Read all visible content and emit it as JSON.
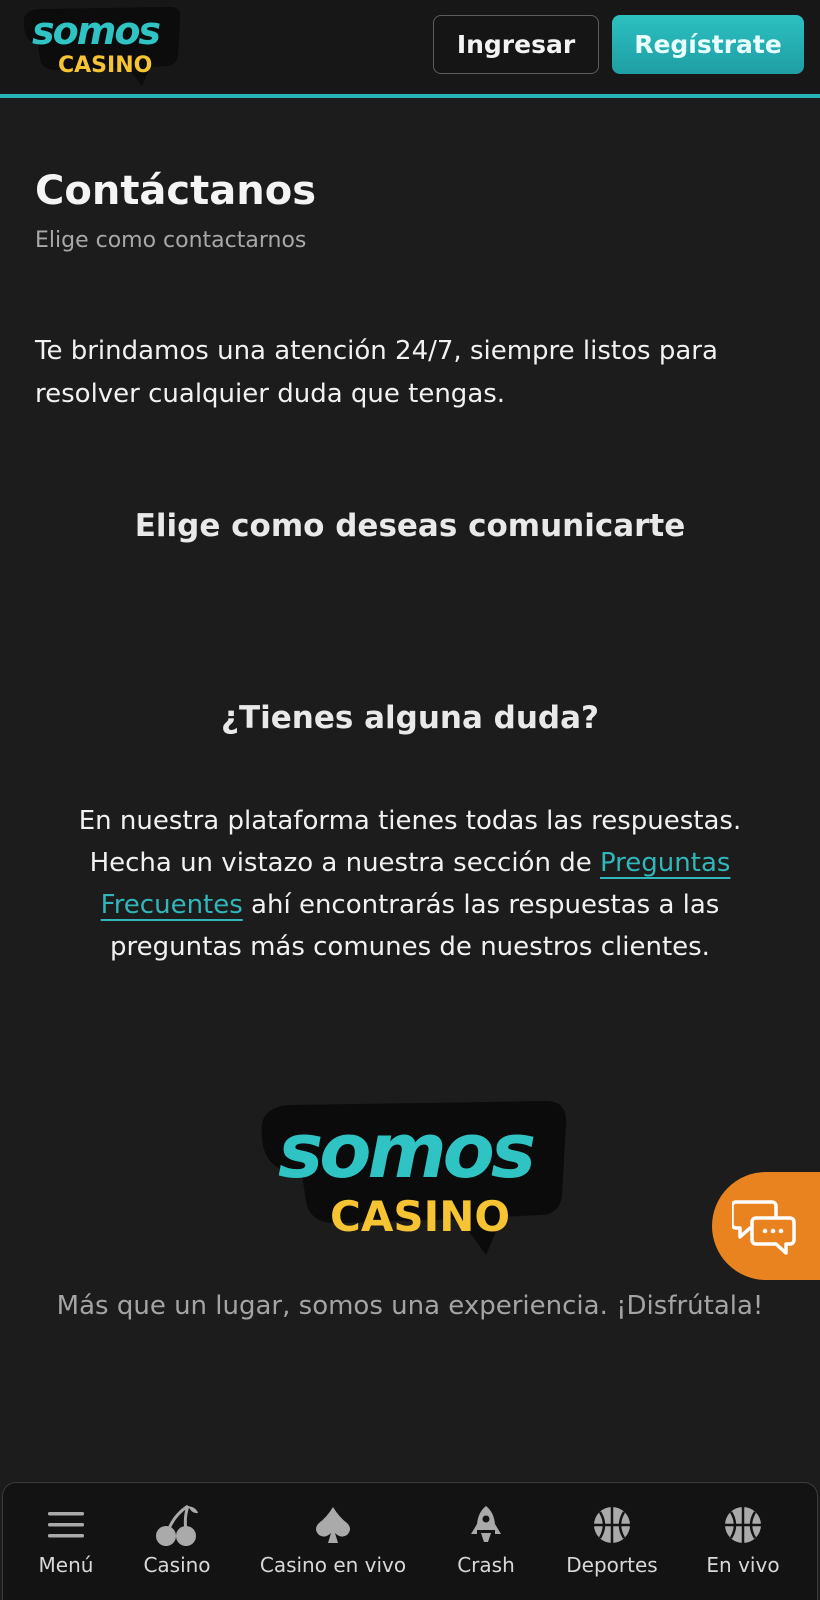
{
  "header": {
    "logo": {
      "line1": "somos",
      "line2": "CASINO"
    },
    "login_label": "Ingresar",
    "register_label": "Regístrate"
  },
  "main": {
    "title": "Contáctanos",
    "subtitle": "Elige como contactarnos",
    "intro": "Te brindamos una atención 24/7, siempre listos para resolver cualquier duda que tengas.",
    "choose_heading": "Elige como deseas comunicarte",
    "faq": {
      "heading": "¿Tienes alguna duda?",
      "text_before": "En nuestra plataforma tienes todas las respuestas. Hecha un vistazo a nuestra sección de ",
      "link_label": "Preguntas Frecuentes",
      "text_after": " ahí encontrarás las respuestas a las preguntas más comunes de nuestros clientes."
    },
    "tagline": "Más que un lugar, somos una experiencia. ¡Disfrútala!"
  },
  "chat": {
    "icon": "chat-bubbles-icon"
  },
  "bottom_nav": {
    "items": [
      {
        "label": "Menú",
        "icon": "hamburger-icon"
      },
      {
        "label": "Casino",
        "icon": "cherries-icon"
      },
      {
        "label": "Casino en vivo",
        "icon": "spade-icon"
      },
      {
        "label": "Crash",
        "icon": "rocket-icon"
      },
      {
        "label": "Deportes",
        "icon": "basketball-icon"
      },
      {
        "label": "En vivo",
        "icon": "basketball-icon"
      }
    ]
  },
  "colors": {
    "background": "#1b1c1b",
    "accent": "#27b3b7",
    "logo_yellow": "#f6c432",
    "chat_orange": "#e9831f"
  }
}
